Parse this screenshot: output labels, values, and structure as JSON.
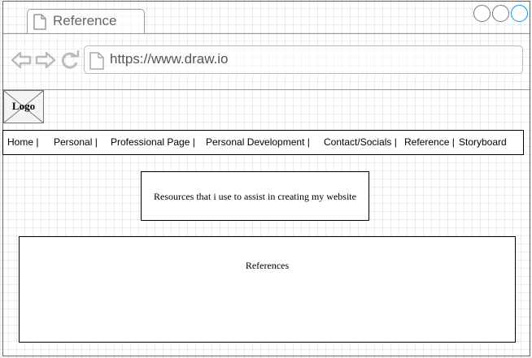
{
  "browser": {
    "tab_title": "Reference",
    "url": "https://www.draw.io"
  },
  "page": {
    "logo_label": "Logo",
    "nav_items": [
      "Home |",
      "Personal |",
      "Professional Page |",
      "Personal Development  |",
      "Contact/Socials |",
      "Reference |",
      "Storyboard"
    ],
    "resources_text": "Resources that i use to assist in creating my website",
    "references_text": "References"
  },
  "icons": {
    "tab": "page-icon",
    "back": "back-arrow-icon",
    "forward": "forward-arrow-icon",
    "reload": "reload-icon",
    "url": "page-icon",
    "logo": "image-placeholder-icon"
  },
  "colors": {
    "ui_gray": "#999999",
    "icon_gray": "#bbbbbb",
    "accent_blue": "#1a8fd9",
    "text": "#000000"
  }
}
